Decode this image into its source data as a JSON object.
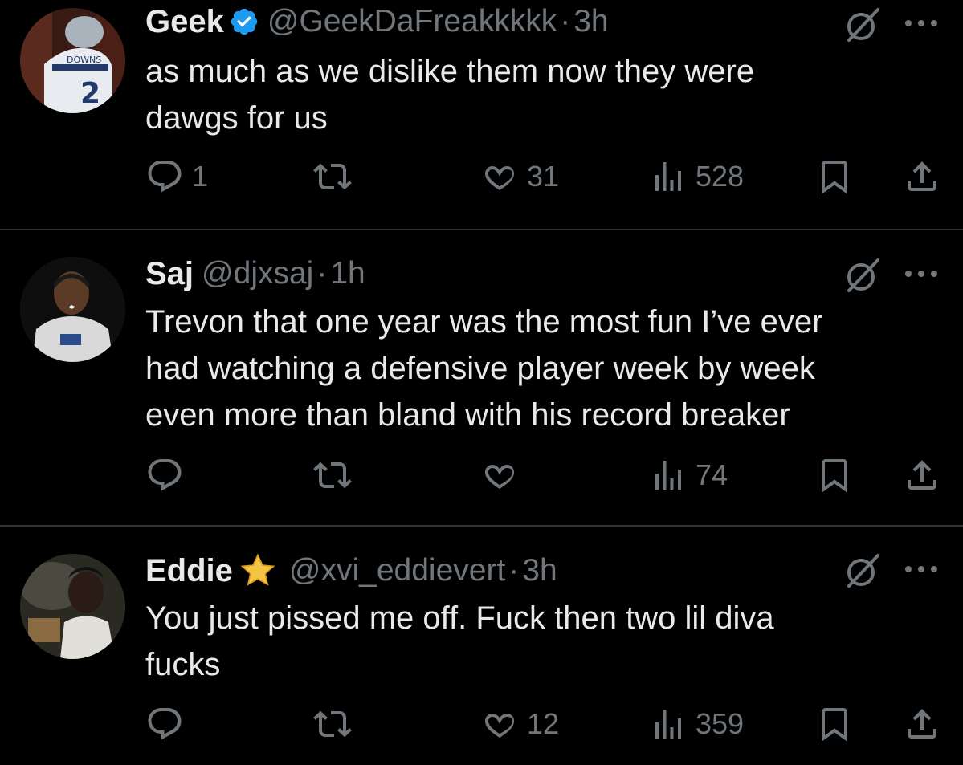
{
  "tweets": [
    {
      "name": "Geek",
      "verified": true,
      "handle": "@GeekDaFreakkkkk",
      "separator": "·",
      "time": "3h",
      "text": "as much as we dislike them now they were\ndawgs for us",
      "avatar_text": {
        "top": "DOWNS",
        "number": "2"
      },
      "actions": {
        "reply": "1",
        "retweet": "",
        "like": "31",
        "views": "528"
      }
    },
    {
      "name": "Saj",
      "verified": false,
      "handle": "@djxsaj",
      "separator": "·",
      "time": "1h",
      "text": "Trevon that one year was the most fun I’ve ever\nhad watching a defensive player week by week\neven more than bland with his record breaker",
      "actions": {
        "reply": "",
        "retweet": "",
        "like": "",
        "views": "74"
      }
    },
    {
      "name": "Eddie",
      "emoji": "star-emoji",
      "handle": "@xvi_eddievert",
      "separator": "·",
      "time": "3h",
      "text": "You just pissed me off. Fuck then two lil diva\nfucks",
      "actions": {
        "reply": "",
        "retweet": "",
        "like": "12",
        "views": "359"
      }
    }
  ],
  "colors": {
    "background": "#000000",
    "text": "#e7e9ea",
    "muted": "#71767b",
    "verified": "#1d9bf0",
    "divider": "#2f3336"
  },
  "icons": [
    "reply-icon",
    "retweet-icon",
    "like-icon",
    "views-icon",
    "bookmark-icon",
    "share-icon",
    "grok-icon",
    "more-icon",
    "verified-badge-icon"
  ]
}
